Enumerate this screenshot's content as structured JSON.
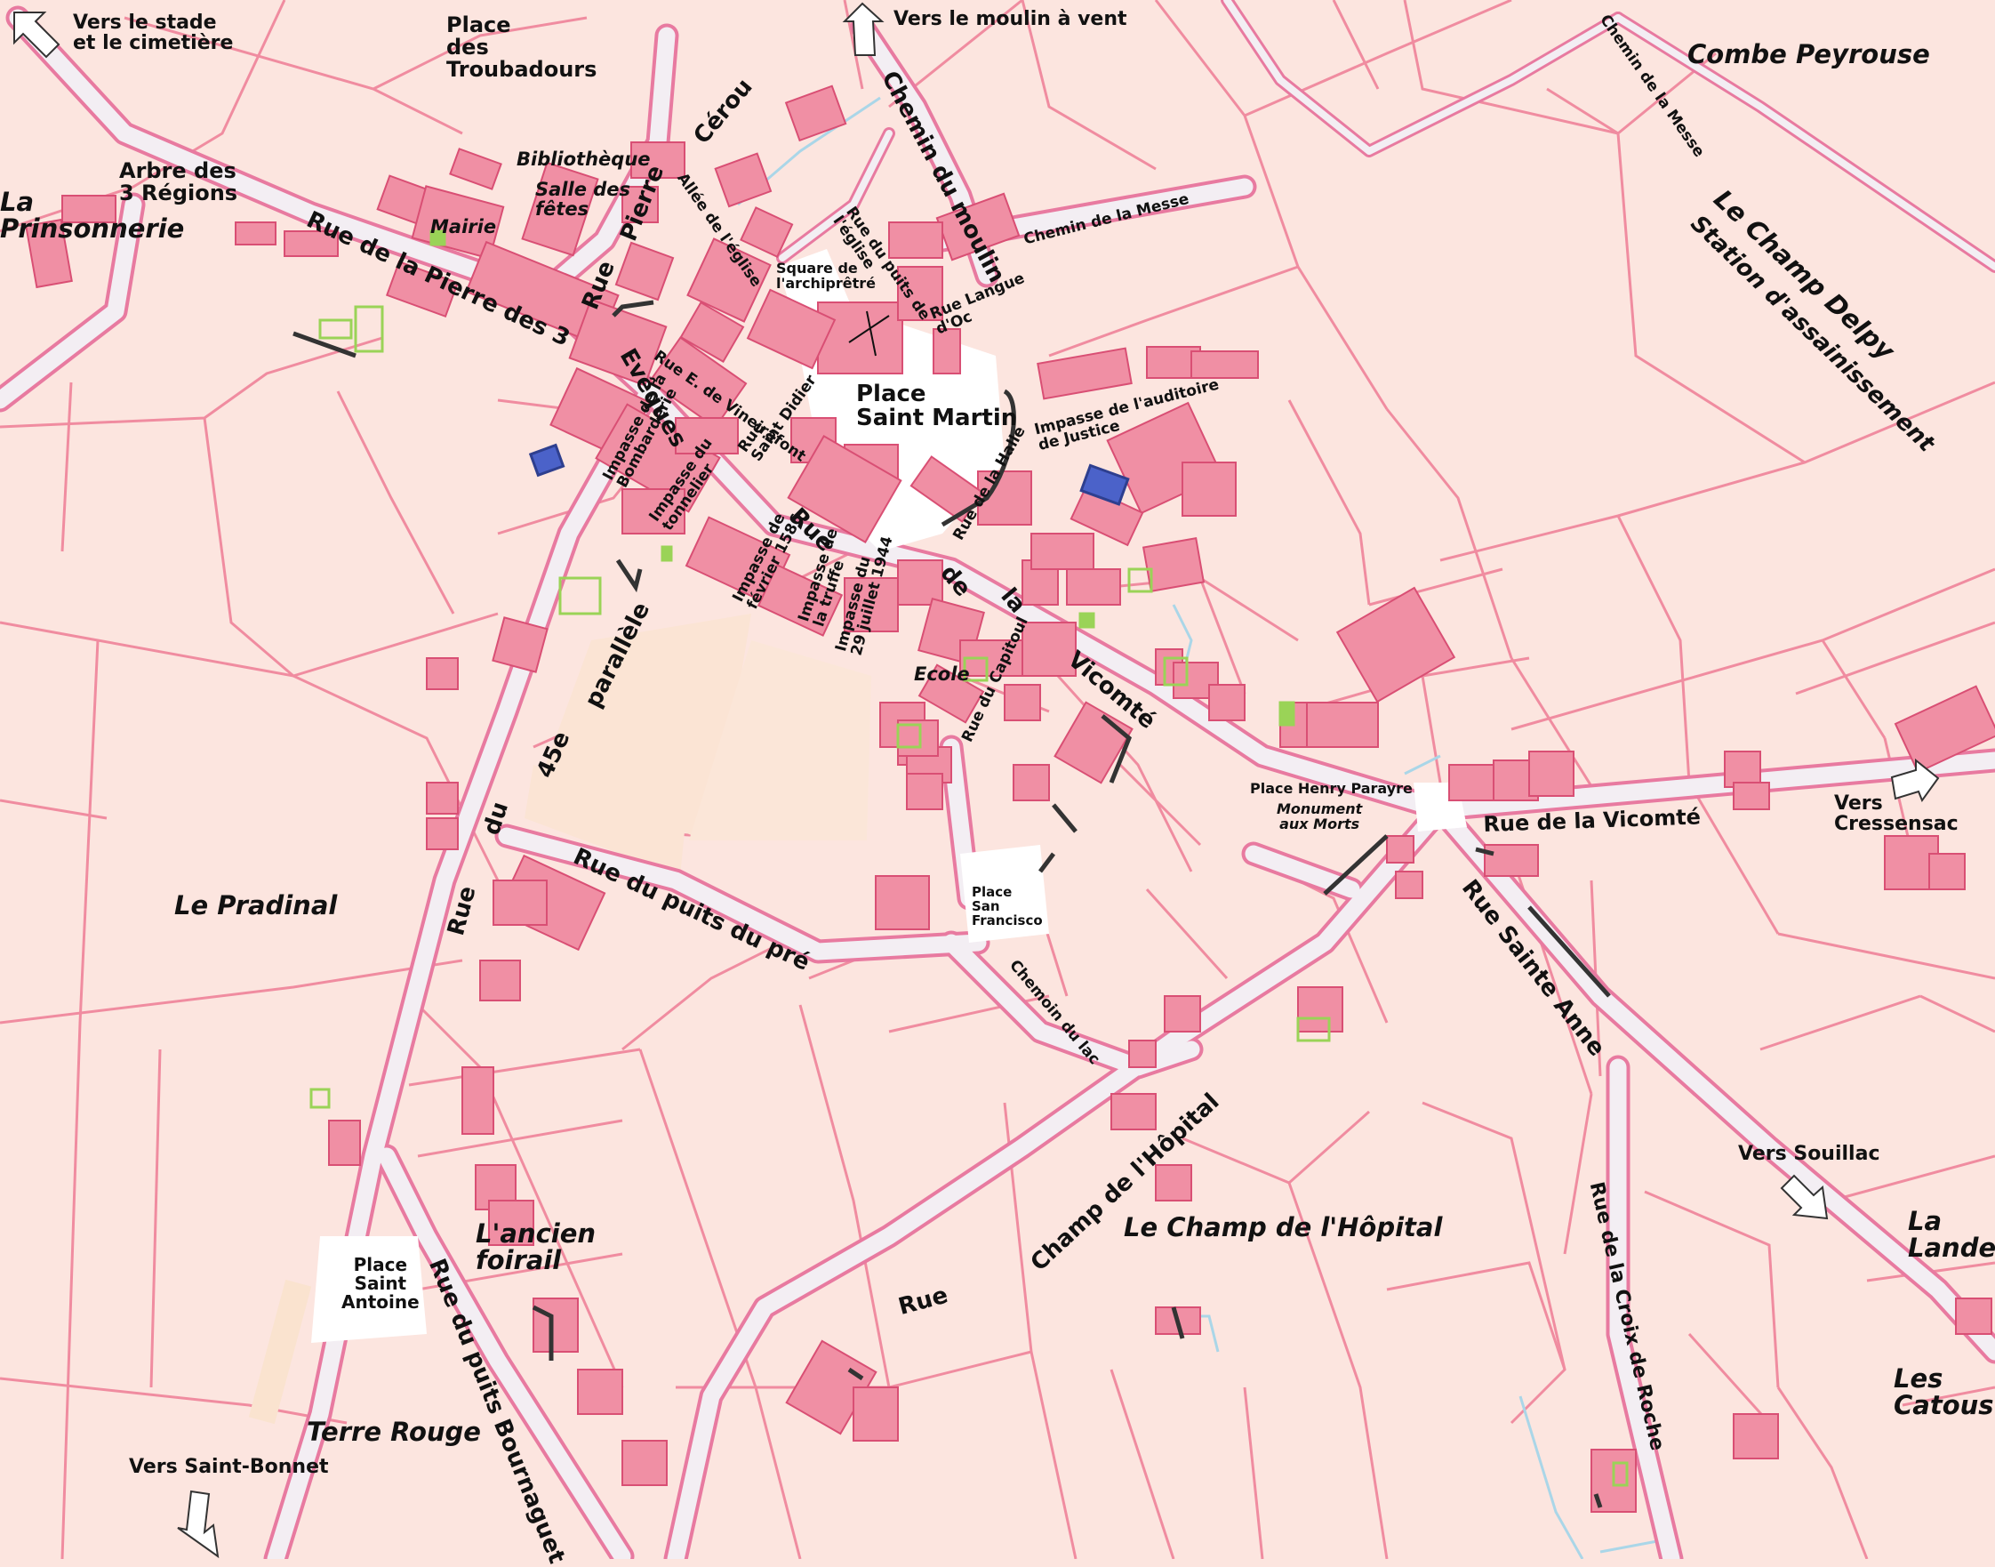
{
  "colors": {
    "background": "#fce5df",
    "parcel_line": "#f08ca0",
    "road_fill": "#f3eef3",
    "road_edge": "#e87aa0",
    "building": "#f08fa4",
    "building_edge": "#d94f74",
    "green": "#9ad357",
    "water": "#aad6e8",
    "church": "#4b62c9",
    "wall": "#333333",
    "text": "#111111"
  },
  "directions": {
    "stade": "Vers le stade\net le cimetière",
    "moulin": "Vers le moulin à vent",
    "cressensac": "Vers\nCressensac",
    "souillac": "Vers Souillac",
    "saint_bonnet": "Vers Saint-Bonnet"
  },
  "areas": {
    "prinsonnerie": "La\nPrinsonnerie",
    "combe_peyrouse": "Combe Peyrouse",
    "champ_delpy": "Le Champ Delpy",
    "station": "Station d'assainissement",
    "pradinal": "Le Pradinal",
    "champ_hopital": "Le Champ de l'Hôpital",
    "ancien_foirail": "L'ancien\nfoirail",
    "terre_rouge": "Terre Rouge",
    "la_lande": "La\nLande",
    "les_catous": "Les\nCatous"
  },
  "places": {
    "troubadours": "Place\ndes\nTroubadours",
    "arbre": "Arbre des\n3 Régions",
    "saint_martin": "Place\nSaint Martin",
    "henry_parayre": "Place Henry Parayre",
    "san_francisco": "Place\nSan\nFrancisco",
    "saint_antoine": "Place\nSaint\nAntoine",
    "square": "Square de\nl'archiprêtré"
  },
  "pois": {
    "bibliotheque": "Bibliothèque",
    "salle": "Salle des\nfêtes",
    "mairie": "Mairie",
    "ecole": "Ecole",
    "monument": "Monument\naux Morts"
  },
  "streets": {
    "pierre_3_eveques_a": "Rue de la Pierre des 3",
    "pierre_3_eveques_b": "Evêques",
    "rue_pierre": "Rue",
    "pierre": "Pierre",
    "cerou": "Cérou",
    "chemin_moulin": "Chemin du moulin",
    "chemin_messe_1": "Chemin de la Messe",
    "chemin_messe_2": "Chemin de la Messe",
    "allee_eglise": "Allée de l'église",
    "puits_eglise": "Rue du puits de\nl'église",
    "langue_oc": "Rue Langue\nd'Oc",
    "vineirafont": "Rue E. de Vineirafont",
    "saint_didier": "Rue\nSaint Didier",
    "bombarderie": "Impasse de la\nBombarderie",
    "tonnelier": "Impasse du\ntonnelier",
    "fevrier": "Impasse de\nfévrier 1586",
    "truffe": "Impasse de\nla truffe",
    "juillet": "Impasse du\n29 juillet 1944",
    "halle": "Rue de la Halle",
    "auditoire": "Impasse de l'auditoire\nde Justice",
    "vicomte_rue": "Rue",
    "vicomte_de": "de",
    "vicomte_la": "la",
    "vicomte_v": "Vicomté",
    "vicomte_east": "Rue de la Vicomté",
    "capitoul": "Rue du Capitoul",
    "parallele_rue": "Rue",
    "parallele_du": "du",
    "parallele_45": "45e",
    "parallele_p": "parallèle",
    "puits_pre": "Rue du puits du pré",
    "lac": "Chemoin du lac",
    "sainte_anne": "Rue Sainte Anne",
    "champ_hopital_rue": "Rue",
    "champ_hopital_st": "Champ de l'Hôpital",
    "croix_roche": "Rue de la Croix de Roche",
    "bournaguet": "Rue du puits Bournaguet"
  }
}
